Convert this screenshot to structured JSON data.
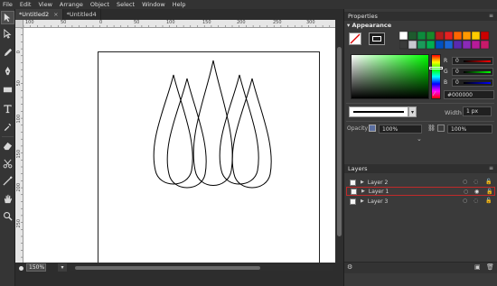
{
  "menu": [
    "File",
    "Edit",
    "View",
    "Arrange",
    "Object",
    "Select",
    "Window",
    "Help"
  ],
  "tabs": [
    {
      "label": "*Untitled2",
      "active": true,
      "close": "×"
    },
    {
      "label": "*Untitled4",
      "active": false
    }
  ],
  "ruler": {
    "h_ticks": [
      "100",
      "50",
      "0",
      "50",
      "100",
      "150",
      "200",
      "250",
      "300"
    ],
    "v_ticks": [
      "0",
      "50",
      "100",
      "150",
      "200",
      "250"
    ]
  },
  "status": {
    "zoom": "150%"
  },
  "properties": {
    "header": "Properties",
    "section": "Appearance",
    "rgb": [
      {
        "label": "R",
        "value": "0"
      },
      {
        "label": "G",
        "value": "0"
      },
      {
        "label": "B",
        "value": "0"
      }
    ],
    "hex": "#000000",
    "width_label": "Width",
    "width_value": "1 px",
    "opacity_label": "Opacity",
    "fill_opacity": "100%",
    "stroke_opacity": "100%",
    "swatch_colors": [
      "#ffffff",
      "#1e5a2e",
      "#0c8a3c",
      "#168a2a",
      "#b31c1c",
      "#e62121",
      "#ff6600",
      "#ff9900",
      "#ffcc00",
      "#cc0000",
      "#3a3a3a",
      "#c8c8d0",
      "#1a9a5a",
      "#00b050",
      "#0050c0",
      "#1a66d6",
      "#5a2ab0",
      "#8a2ab8",
      "#b81a9a",
      "#c81a6a"
    ]
  },
  "layers": {
    "header": "Layers",
    "items": [
      {
        "name": "Layer 2",
        "selected": false
      },
      {
        "name": "Layer 1",
        "selected": true
      },
      {
        "name": "Layer 3",
        "selected": false
      }
    ]
  }
}
